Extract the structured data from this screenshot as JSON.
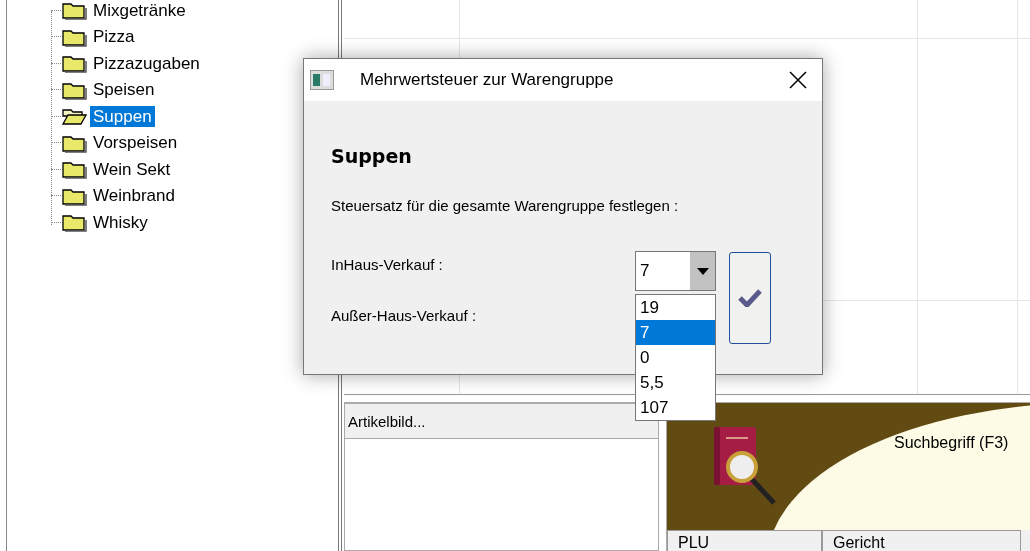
{
  "tree": {
    "items": [
      {
        "label": "Mixgetränke",
        "selected": false
      },
      {
        "label": "Pizza",
        "selected": false
      },
      {
        "label": "Pizzazugaben",
        "selected": false
      },
      {
        "label": "Speisen",
        "selected": false
      },
      {
        "label": "Suppen",
        "selected": true
      },
      {
        "label": "Vorspeisen",
        "selected": false
      },
      {
        "label": "Wein Sekt",
        "selected": false
      },
      {
        "label": "Weinbrand",
        "selected": false
      },
      {
        "label": "Whisky",
        "selected": false
      }
    ]
  },
  "image_panel": {
    "title": "Artikelbild..."
  },
  "search_panel": {
    "label": "Suchbegriff (F3)",
    "columns": [
      "PLU",
      "Gericht"
    ]
  },
  "dialog": {
    "title": "Mehrwertsteuer zur Warengruppe",
    "heading": "Suppen",
    "instruction": "Steuersatz für die gesamte Warengruppe festlegen :",
    "fields": [
      {
        "label": "InHaus-Verkauf :",
        "value": "7"
      },
      {
        "label": "Außer-Haus-Verkauf :"
      }
    ],
    "dropdown": {
      "options": [
        {
          "label": "19",
          "selected": false
        },
        {
          "label": "7",
          "selected": true
        },
        {
          "label": "0",
          "selected": false
        },
        {
          "label": "5,5",
          "selected": false
        },
        {
          "label": "107",
          "selected": false
        }
      ]
    }
  }
}
